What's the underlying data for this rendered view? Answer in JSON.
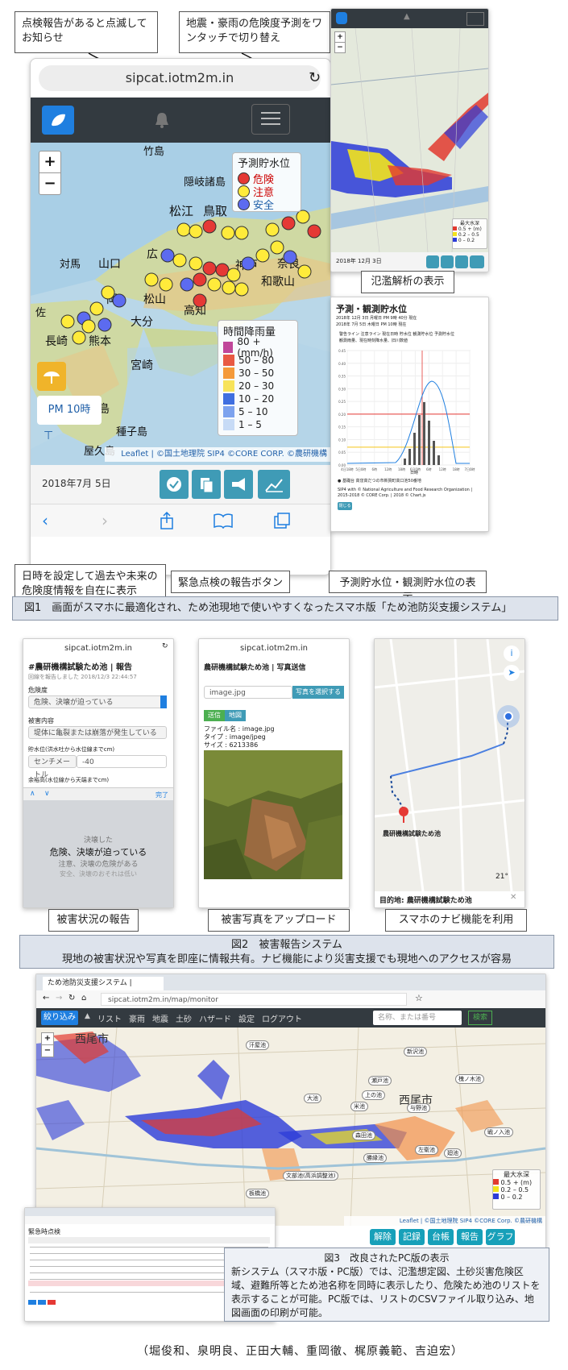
{
  "fig1": {
    "callout_notify": "点検報告があると点滅してお知らせ",
    "callout_toggle": "地震・豪雨の危険度予測をワンタッチで切り替え",
    "callout_date": "日時を設定して過去や未来の危険度情報を自在に表示",
    "callout_emergency": "緊急点検の報告ボタン",
    "label_flood": "氾濫解析の表示",
    "label_level": "予測貯水位・観測貯水位の表示",
    "caption": "図1　画面がスマホに最適化され、ため池現地で使いやすくなったスマホ版「ため池防災支援システム」",
    "phone": {
      "url": "sipcat.iotm2m.in",
      "legend_title": "予測貯水位",
      "legend_items": [
        {
          "label": "危険",
          "color": "#e53935"
        },
        {
          "label": "注意",
          "color": "#ffeb3b"
        },
        {
          "label": "安全",
          "color": "#5c6bf0"
        }
      ],
      "rain_title": "時間降雨量",
      "rain_items": [
        {
          "label": "80 + (mm/h)",
          "color": "#c0479a"
        },
        {
          "label": "50 – 80",
          "color": "#e85a43"
        },
        {
          "label": "30 – 50",
          "color": "#f49a3a"
        },
        {
          "label": "20 – 30",
          "color": "#f7e35a"
        },
        {
          "label": "10 – 20",
          "color": "#3f6fe0"
        },
        {
          "label": "5 – 10",
          "color": "#7ca2ee"
        },
        {
          "label": "1 – 5",
          "color": "#c7dbf6"
        }
      ],
      "time_label": "PM 10時",
      "place_names": [
        "竹島",
        "隠岐諸島",
        "松江",
        "鳥取",
        "対馬",
        "山口",
        "広",
        "神戸",
        "奈良",
        "和歌山",
        "岡",
        "松山",
        "高知",
        "大分",
        "長崎",
        "熊本",
        "宮崎",
        "鹿児島",
        "種子島",
        "屋久島",
        "佐"
      ],
      "attribution": "Leaflet | ©国土地理院 SIP4 ©CORE CORP. ©農研機構",
      "date": "2018年7月 5日",
      "zoom_in": "+",
      "zoom_out": "−"
    },
    "flood_phone": {
      "legend_title": "最大水深",
      "legend_items": [
        "0.5 + (m)",
        "0.2 – 0.5",
        "0 – 0.2"
      ],
      "date": "2018年 12月 3日"
    },
    "level_panel": {
      "title": "予測・観測貯水位",
      "line1": "2018年 12月 3日 月曜日 PM 9時 40分 現在",
      "line2": "2018年 7月 5日 木曜日 PM 10時 現在",
      "legend_row": "警告ライン   注意ライン   現在日時   貯水位   観測貯水位   予測貯水位",
      "legend_row2": "観測雨量、現在時刻降水量、旧川数値",
      "y_ticks": [
        "0.45",
        "0.40",
        "0.35",
        "0.30",
        "0.25",
        "0.20",
        "0.15",
        "0.10",
        "0.05",
        "0.00"
      ],
      "x_ticks": [
        "4日18時",
        "5日0時",
        "6時",
        "12時",
        "18時",
        "6日0時",
        "6時",
        "12時",
        "18時",
        "7日0時"
      ],
      "x_label": "日時",
      "note": "● 基礎台 高窪高だつの市新質町高口池50番地",
      "footer": "SIP4 with © National Agriculture and Food Research Organization | 2015-2018 © CORE Corp. | 2018 © Chart.js",
      "close": "閉じる"
    }
  },
  "fig2": {
    "label_report": "被害状況の報告",
    "label_photo": "被害写真をアップロード",
    "label_nav": "スマホのナビ機能を利用",
    "caption_title": "図2　被害報告システム",
    "caption_text": "現地の被害状況や写真を即座に情報共有。ナビ機能により災害支援でも現地へのアクセスが容易",
    "report": {
      "url": "sipcat.iotm2m.in",
      "title": "#農研機構試験ため池 | 報告",
      "timestamp": "回線を報告しました 2018/12/3 22:44:57",
      "danger_label": "危険度",
      "danger_value": "危険、決壊が迫っている",
      "damage_label": "被害内容",
      "damage_value": "堤体に亀裂または崩落が発生している",
      "level_label": "貯水位(洪水吐から水位線までcm)",
      "level_unit": "センチメートル",
      "level_value": "-40",
      "margin_label": "余裕高(水位線から天端までcm)",
      "done": "完了",
      "picker": [
        "決壊した",
        "危険、決壊が迫っている",
        "注意、決壊の危険がある",
        "安全、決壊のおそれは低い"
      ]
    },
    "photo": {
      "url": "sipcat.iotm2m.in",
      "title": "農研機構試験ため池 | 写真送信",
      "file_value": "image.jpg",
      "choose": "写真を選択する",
      "send": "送信",
      "map": "地図",
      "info1": "ファイル名 : image.jpg",
      "info2": "タイプ : image/jpeg",
      "info3": "サイズ : 6213386"
    },
    "nav": {
      "destination": "目的地: 農研機構試験ため池",
      "temp": "21°",
      "pin_label": "農研機構試験ため池"
    }
  },
  "fig3": {
    "tab_title": "ため池防災支援システム |",
    "url": "sipcat.iotm2m.in/map/monitor",
    "narrow_btn": "絞り込み",
    "nav_items": [
      "リスト",
      "豪雨",
      "地震",
      "土砂",
      "ハザード",
      "設定",
      "ログアウト"
    ],
    "search_placeholder": "名称、または番号",
    "search_btn": "検索",
    "city_labels": [
      "西尾市",
      "西尾市"
    ],
    "pond_labels": [
      "汗屋池",
      "新沢池",
      "瀬戸池",
      "上の池",
      "槐ノ木池",
      "与野池",
      "大池",
      "米池",
      "森田池",
      "廻池",
      "左衛池",
      "勝縁池",
      "戦ノ入池",
      "文部池(高浜調整池)",
      "板橋池"
    ],
    "legend_title": "最大水深",
    "legend_items": [
      "0.5 + (m)",
      "0.2 – 0.5",
      "0 – 0.2"
    ],
    "attribution": "Leaflet | ©国土地理院 SIP4 ©CORE Corp. ©農研機構",
    "buttons": [
      "解除",
      "記録",
      "台帳",
      "報告",
      "グラフ"
    ],
    "list_title": "緊急時点検",
    "caption_title": "図3　改良されたPC版の表示",
    "caption_text": "新システム（スマホ版・PC版）では、氾濫想定図、土砂災害危険区域、避難所等とため池名称を同時に表示したり、危険ため池のリストを表示することが可能。PC版では、リストのCSVファイル取り込み、地図画面の印刷が可能。"
  },
  "authors": "（堀俊和、泉明良、正田大輔、重岡徹、梶原義範、吉迫宏）"
}
